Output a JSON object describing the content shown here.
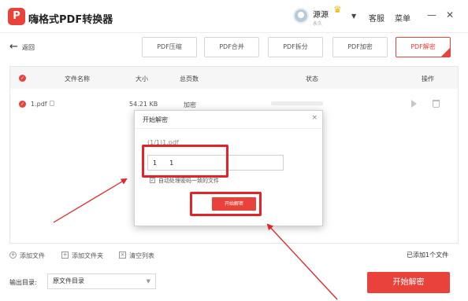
{
  "app": {
    "title": "嗨格式PDF转换器",
    "logo_glyph": "P"
  },
  "user": {
    "name": "源源",
    "sub": "永久"
  },
  "header_links": {
    "service": "客服",
    "menu": "菜单"
  },
  "window_controls": {
    "minimize": "—",
    "close": "✕"
  },
  "nav": {
    "back": "返回"
  },
  "tabs": [
    {
      "label": "PDF压缩"
    },
    {
      "label": "PDF合并"
    },
    {
      "label": "PDF拆分"
    },
    {
      "label": "PDF加密"
    },
    {
      "label": "PDF解密",
      "active": true
    }
  ],
  "table": {
    "columns": {
      "name": "文件名称",
      "size": "大小",
      "pages": "总页数",
      "status": "状态",
      "action": "操作"
    },
    "rows": [
      {
        "name": "1.pdf",
        "size": "54.21 KB",
        "pages": "加密"
      }
    ]
  },
  "dialog": {
    "title": "开始解密",
    "close": "×",
    "file_label": "(1/1)1.pdf",
    "password_value": "1　　1",
    "checkbox_label": "自动处理密码一致的文件",
    "checkbox_checked": true,
    "confirm": "开始解密"
  },
  "bottom_bar": {
    "add_file": "添加文件",
    "add_folder": "添加文件夹",
    "clear_list": "清空列表",
    "added_count": "已添加1个文件"
  },
  "output": {
    "label": "输出目录:",
    "value": "原文件目录"
  },
  "start_button": "开始解密",
  "colors": {
    "accent": "#e8423a",
    "highlight": "#e0242a"
  }
}
